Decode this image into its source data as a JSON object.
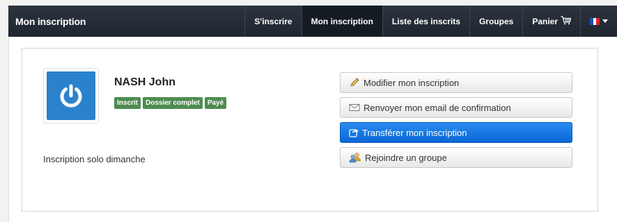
{
  "navbar": {
    "brand": "Mon inscription",
    "items": [
      {
        "label": "S'inscrire",
        "active": false
      },
      {
        "label": "Mon inscription",
        "active": true
      },
      {
        "label": "Liste des inscrits",
        "active": false
      },
      {
        "label": "Groupes",
        "active": false
      }
    ],
    "cart_label": "Panier",
    "cart_icon": "cart-icon",
    "language_icon": "french-flag-icon"
  },
  "profile": {
    "name": "NASH John",
    "avatar_icon": "power-icon",
    "badges": [
      "Inscrit",
      "Dossier complet",
      "Payé"
    ],
    "description": "Inscription solo dimanche"
  },
  "actions": [
    {
      "label": "Modifier mon inscription",
      "icon": "pencil-icon"
    },
    {
      "label": "Renvoyer mon email de confirmation",
      "icon": "envelope-icon"
    },
    {
      "label": "Transférer mon inscription",
      "icon": "share-icon"
    },
    {
      "label": "Rejoindre un groupe",
      "icon": "users-icon"
    }
  ],
  "colors": {
    "navbar": "#232a34",
    "primary_button": "#1a7ae4",
    "badge": "#4e8b4f",
    "avatar": "#2b82cc"
  }
}
